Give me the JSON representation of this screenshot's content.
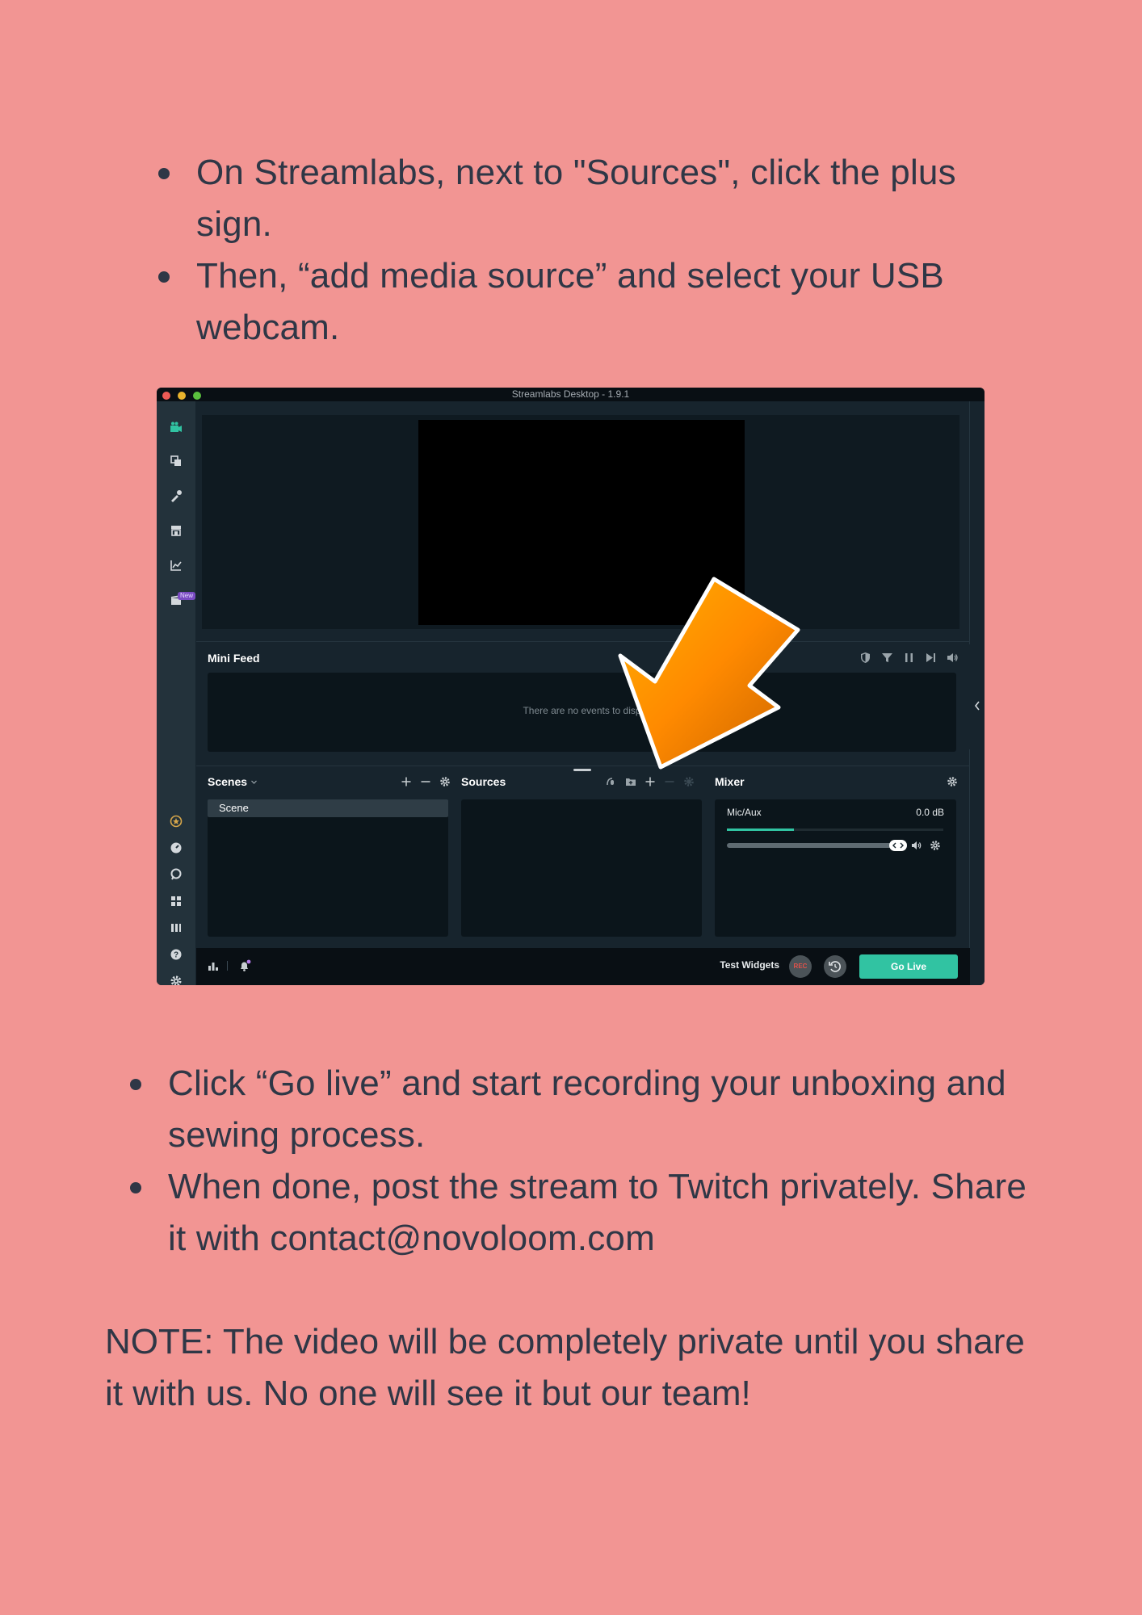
{
  "instructions_top": [
    "On Streamlabs, next to \"Sources\", click the plus sign.",
    "Then, “add media source” and select your USB webcam."
  ],
  "instructions_bottom": [
    "Click “Go live” and start recording your unboxing and sewing process.",
    "When done, post the stream to Twitch privately. Share it with contact@novoloom.com"
  ],
  "note": "NOTE: The video will be completely private until you share it with us. No one will see it but our team!",
  "app": {
    "window_title": "Streamlabs Desktop - 1.9.1",
    "new_badge": "New",
    "mini_feed": {
      "title": "Mini Feed",
      "empty_text": "There are no events to disp"
    },
    "scenes": {
      "title": "Scenes",
      "items": [
        "Scene"
      ]
    },
    "sources": {
      "title": "Sources"
    },
    "mixer": {
      "title": "Mixer",
      "channel_name": "Mic/Aux",
      "channel_db": "0.0 dB",
      "meter_level": 0.31
    },
    "footer": {
      "test_widgets": "Test Widgets",
      "rec_label": "REC",
      "go_live": "Go Live"
    },
    "colors": {
      "accent": "#31c3a2",
      "page_background": "#f29593",
      "callout_arrow": "#ff9a00"
    },
    "icons": {
      "left_nav": [
        "editor-icon",
        "layouts-icon",
        "themes-icon",
        "store-icon",
        "analytics-icon",
        "highlighter-icon",
        "prime-icon",
        "dashboard-icon",
        "chat-icon",
        "apps-icon",
        "layout-editor-icon",
        "help-icon",
        "settings-icon"
      ],
      "mini_feed_tools": [
        "shield-icon",
        "filter-icon",
        "pause-icon",
        "skip-icon",
        "volume-icon"
      ],
      "callout": "orange-arrow-icon"
    }
  }
}
